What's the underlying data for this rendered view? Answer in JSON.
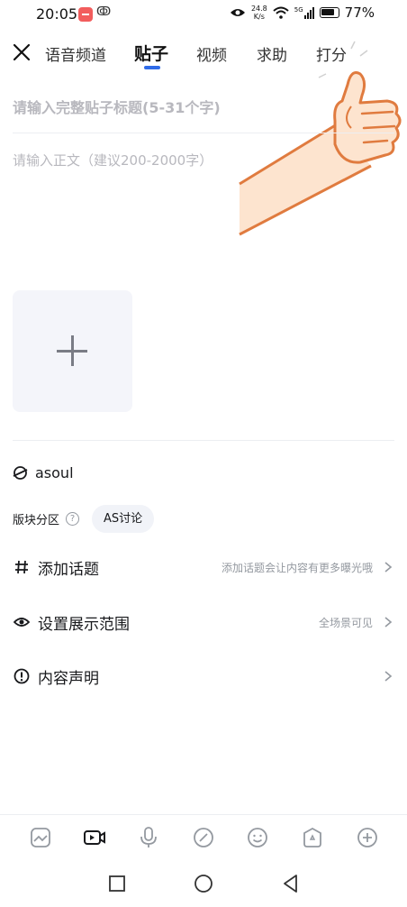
{
  "status_bar": {
    "time": "20:05",
    "net_speed_value": "24.8",
    "net_speed_unit": "K/s",
    "signal": "5G",
    "battery": "77%"
  },
  "nav": {
    "tabs": [
      {
        "label": "语音频道",
        "active": false
      },
      {
        "label": "贴子",
        "active": true
      },
      {
        "label": "视频",
        "active": false
      },
      {
        "label": "求助",
        "active": false
      },
      {
        "label": "打分",
        "active": false
      }
    ]
  },
  "editor": {
    "title_placeholder": "请输入完整贴子标题(5-31个字)",
    "body_placeholder": "请输入正文（建议200-2000字）"
  },
  "channel": {
    "name": "asoul"
  },
  "zone": {
    "label": "版块分区",
    "tag": "AS讨论"
  },
  "rows": [
    {
      "label": "添加话题",
      "value": "添加话题会让内容有更多曝光哦",
      "icon": "hash-icon"
    },
    {
      "label": "设置展示范围",
      "value": "全场景可见",
      "icon": "eye-icon"
    },
    {
      "label": "内容声明",
      "value": "",
      "icon": "alert-icon"
    }
  ],
  "colors": {
    "accent": "#2f6be8",
    "placeholder": "#b8b8be",
    "muted": "#9499a0",
    "tag_bg": "#f1f3f8",
    "image_slot_bg": "#f4f5fa"
  }
}
